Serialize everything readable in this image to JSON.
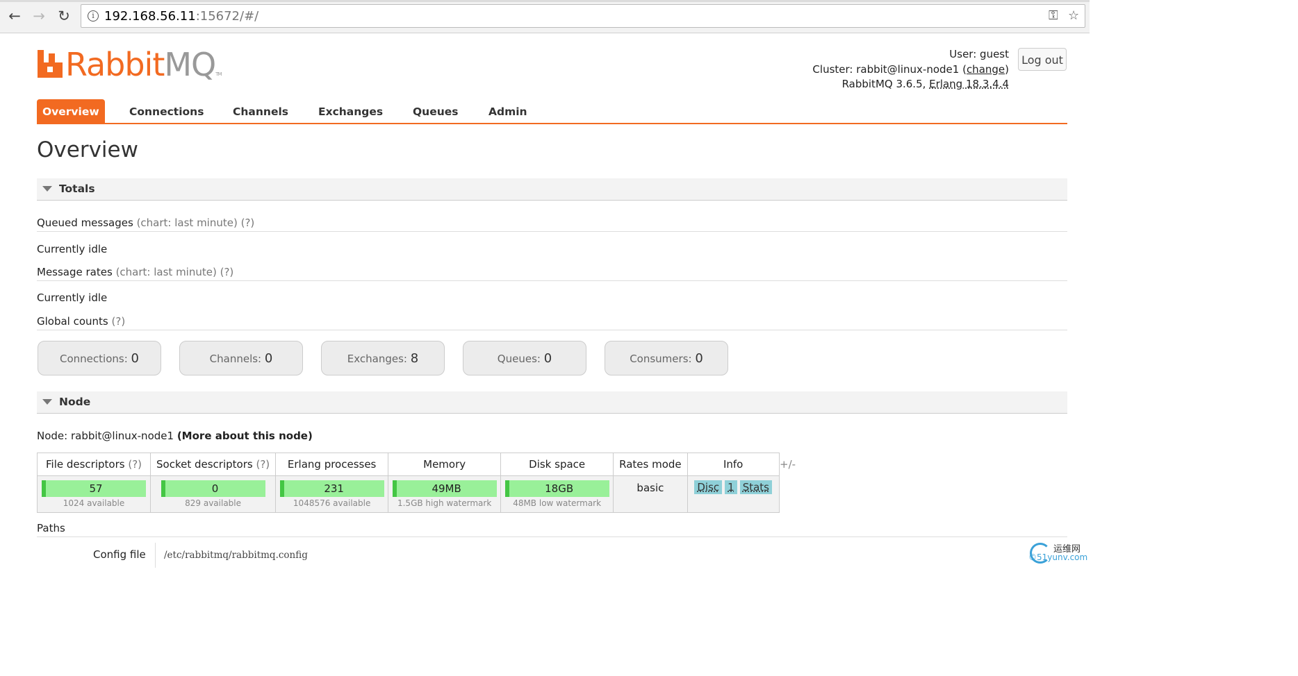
{
  "browser": {
    "url_host": "192.168.56.11",
    "url_rest": ":15672/#/",
    "back_glyph": "←",
    "forward_glyph": "→",
    "reload_glyph": "↻",
    "info_glyph": "i",
    "key_glyph": "⚿",
    "star_glyph": "☆"
  },
  "logo": {
    "word_rabbit": "Rabbit",
    "word_mq": "MQ",
    "tm": "TM"
  },
  "header": {
    "user_label": "User:",
    "user_name": "guest",
    "cluster_label": "Cluster:",
    "cluster_name": "rabbit@linux-node1",
    "change_label": "change",
    "version_label": "RabbitMQ 3.6.5,",
    "erlang_label": "Erlang 18.3.4.4",
    "logout_label": "Log out"
  },
  "tabs": [
    "Overview",
    "Connections",
    "Channels",
    "Exchanges",
    "Queues",
    "Admin"
  ],
  "page_title": "Overview",
  "totals": {
    "title": "Totals",
    "queued_label": "Queued messages",
    "queued_hint": "(chart: last minute) (?)",
    "queued_status": "Currently idle",
    "rates_label": "Message rates",
    "rates_hint": "(chart: last minute) (?)",
    "rates_status": "Currently idle",
    "global_label": "Global counts",
    "global_hint": "(?)",
    "counters": [
      {
        "label": "Connections:",
        "value": "0"
      },
      {
        "label": "Channels:",
        "value": "0"
      },
      {
        "label": "Exchanges:",
        "value": "8"
      },
      {
        "label": "Queues:",
        "value": "0"
      },
      {
        "label": "Consumers:",
        "value": "0"
      }
    ]
  },
  "node": {
    "title": "Node",
    "node_label": "Node: rabbit@linux-node1",
    "more_link": "(More about this node)",
    "columns": {
      "fd": "File descriptors",
      "fd_hint": "(?)",
      "sd": "Socket descriptors",
      "sd_hint": "(?)",
      "ep": "Erlang processes",
      "mem": "Memory",
      "disk": "Disk space",
      "rates": "Rates mode",
      "info": "Info"
    },
    "values": {
      "fd": "57",
      "fd_avail": "1024 available",
      "sd": "0",
      "sd_avail": "829 available",
      "ep": "231",
      "ep_avail": "1048576 available",
      "mem": "49MB",
      "mem_avail": "1.5GB high watermark",
      "disk": "18GB",
      "disk_avail": "48MB low watermark",
      "rates": "basic",
      "info_disc": "Disc",
      "info_one": "1",
      "info_stats": "Stats"
    },
    "plus_minus": "+/-"
  },
  "paths": {
    "title": "Paths",
    "config_label": "Config file",
    "config_value": "/etc/rabbitmq/rabbitmq.config"
  },
  "watermark": {
    "line1": "运维网",
    "line2": "©51yunv.com"
  },
  "colors": {
    "accent": "#f26a21",
    "bar_fill": "#99f099",
    "bar_edge": "#44c644",
    "info_btn": "#8fd0d8"
  }
}
